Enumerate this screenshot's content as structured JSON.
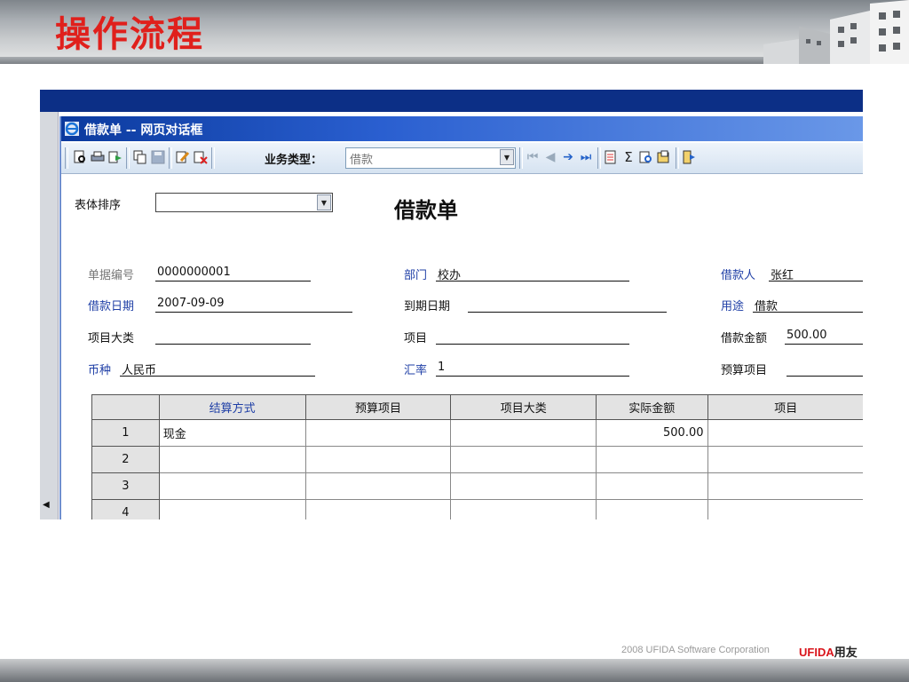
{
  "slide": {
    "title": "操作流程",
    "footer_copyright": "2008 UFIDA Software Corporation",
    "footer_brand": "UFIDA",
    "footer_brand_cn": "用友"
  },
  "dialog": {
    "title": "借款单 -- 网页对话框"
  },
  "toolbar": {
    "biz_type_label": "业务类型：",
    "biz_type_value": "借款",
    "icons": [
      "preview-icon",
      "print-icon",
      "export-icon",
      "copy-icon",
      "save-icon",
      "edit-icon",
      "delete-icon",
      "first-record-icon",
      "prev-record-icon",
      "next-record-icon",
      "last-record-icon",
      "document-icon",
      "sum-icon",
      "query-icon",
      "attachment-icon",
      "exit-icon"
    ]
  },
  "form": {
    "sort_label": "表体排序",
    "sort_value": "",
    "title": "借款单",
    "fields": {
      "doc_no_label": "单据编号",
      "doc_no_value": "0000000001",
      "dept_label": "部门",
      "dept_value": "校办",
      "borrower_label": "借款人",
      "borrower_value": "张红",
      "date_label": "借款日期",
      "date_value": "2007-09-09",
      "due_date_label": "到期日期",
      "due_date_value": "",
      "purpose_label": "用途",
      "purpose_value": "借款",
      "proj_cat_label": "项目大类",
      "proj_cat_value": "",
      "project_label": "项目",
      "project_value": "",
      "amount_label": "借款金额",
      "amount_value": "500.00",
      "currency_label": "币种",
      "currency_value": "人民币",
      "rate_label": "汇率",
      "rate_value": "1",
      "budget_label": "预算项目",
      "budget_value": ""
    }
  },
  "table": {
    "headers": [
      "",
      "结算方式",
      "预算项目",
      "项目大类",
      "实际金额",
      "项目"
    ],
    "rows": [
      [
        "1",
        "现金",
        "",
        "",
        "500.00",
        ""
      ],
      [
        "2",
        "",
        "",
        "",
        "",
        ""
      ],
      [
        "3",
        "",
        "",
        "",
        "",
        ""
      ],
      [
        "4",
        "",
        "",
        "",
        "",
        ""
      ]
    ]
  },
  "colors": {
    "title_red": "#e0201c",
    "nav_blue": "#0c2f86",
    "label_blue": "#1f3fa6"
  }
}
